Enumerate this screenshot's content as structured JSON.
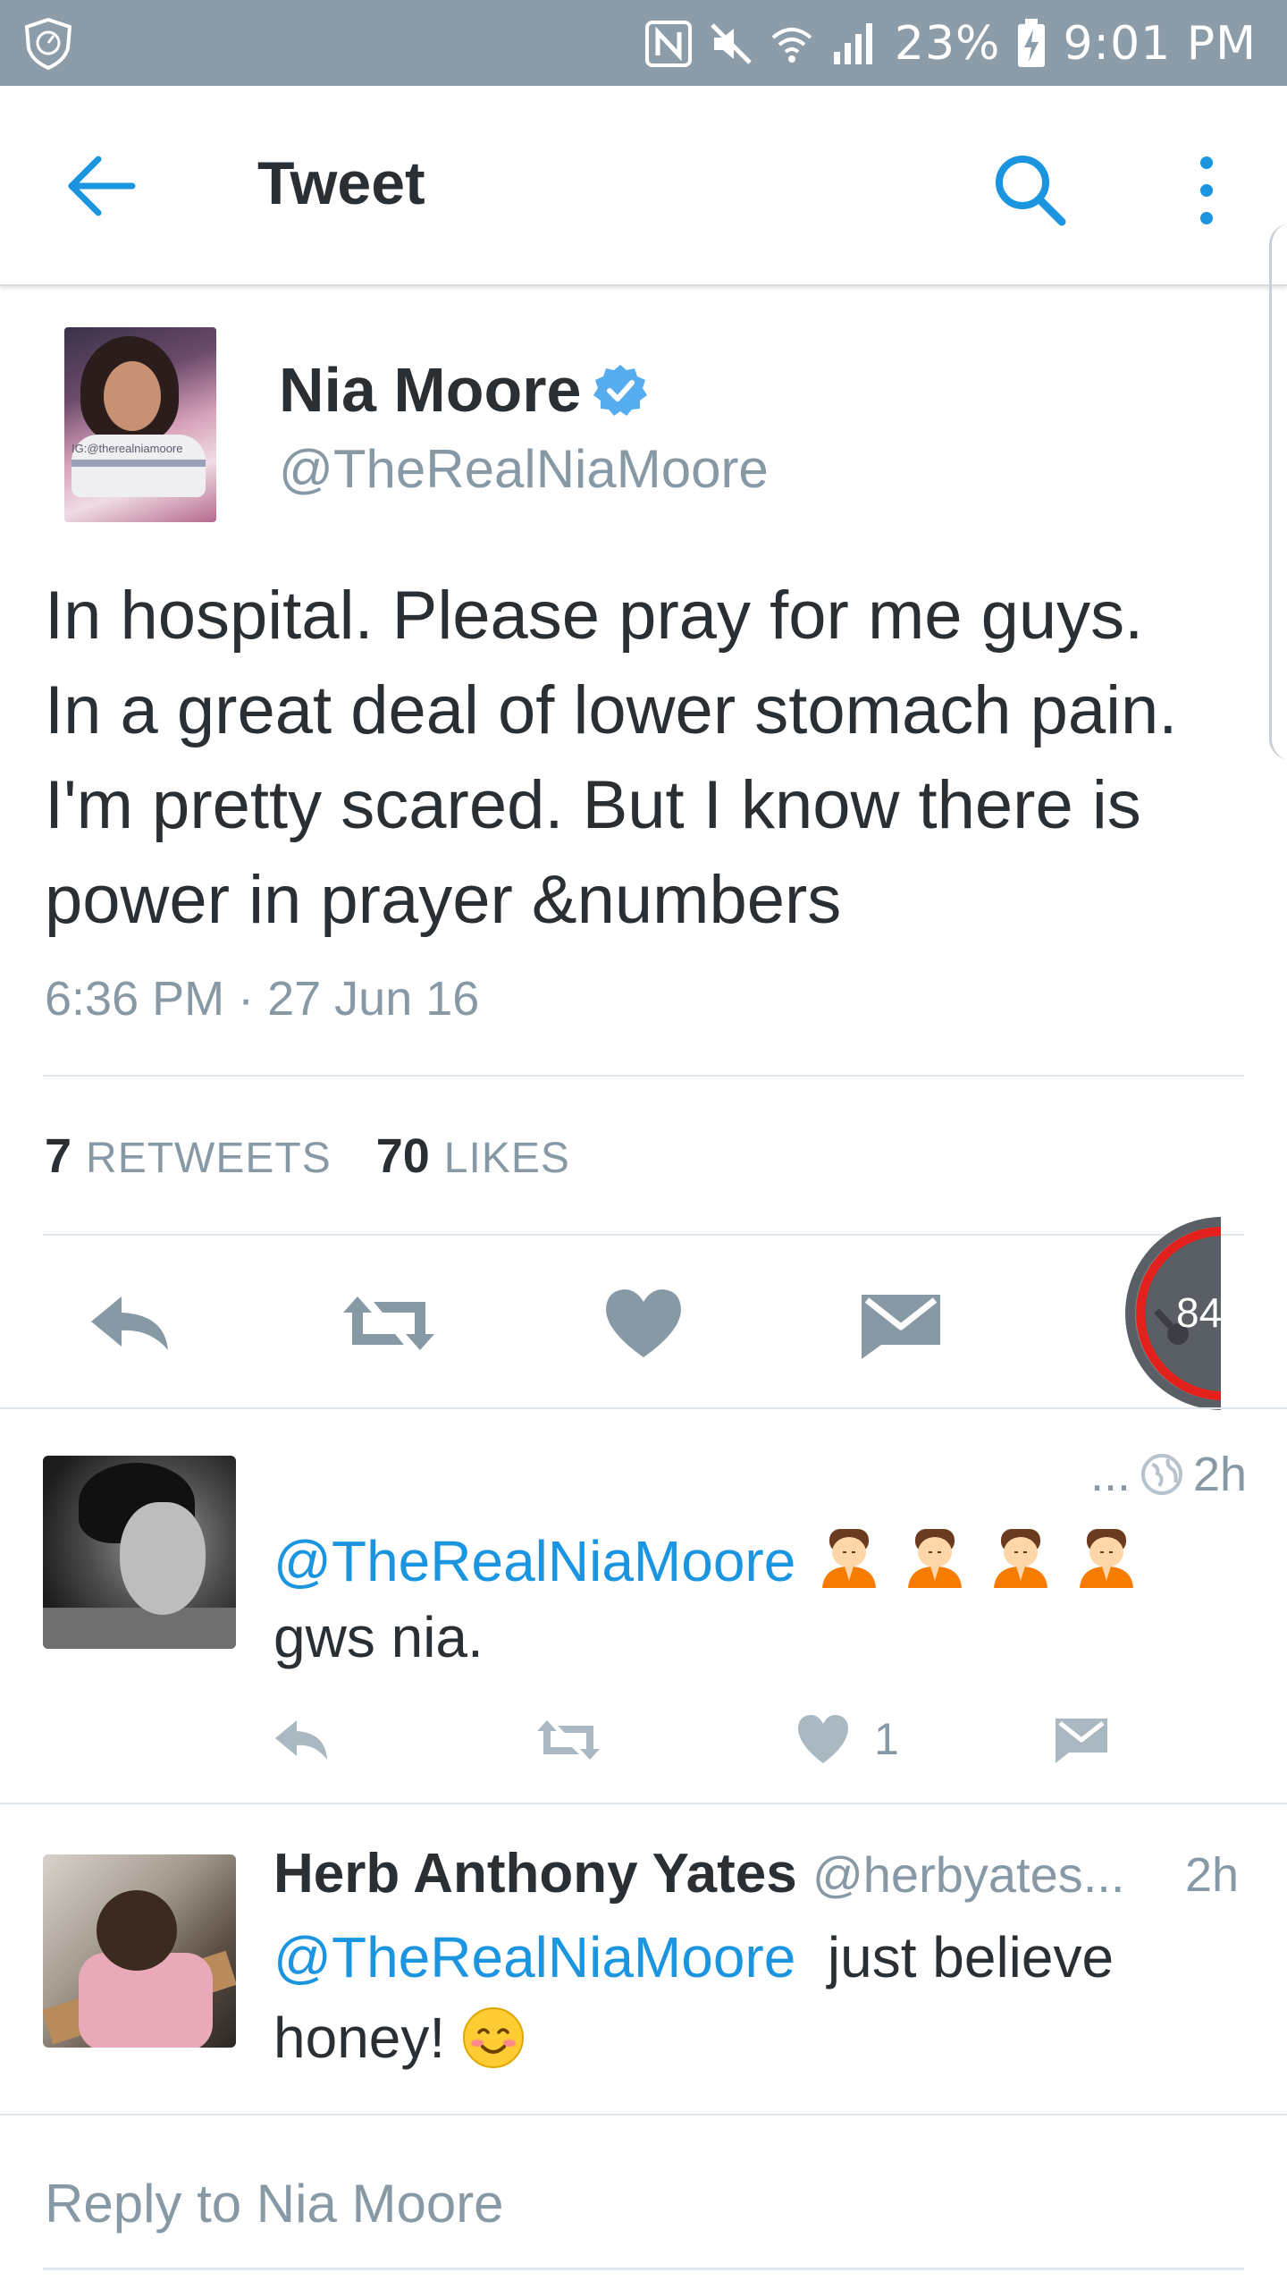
{
  "status_bar": {
    "battery": "23%",
    "time": "9:01 PM"
  },
  "toolbar": {
    "title": "Tweet"
  },
  "tweet": {
    "author_name": "Nia Moore",
    "author_handle": "@TheRealNiaMoore",
    "avatar_caption": "IG:@therealniamoore",
    "text_lines": [
      "In hospital. Please pray for me guys.",
      "In a great deal of lower stomach pain.",
      "I'm pretty scared. But I know there is",
      "power in prayer &numbers"
    ],
    "timestamp": "6:36 PM · 27 Jun 16",
    "retweets_count": "7",
    "retweets_label": "RETWEETS",
    "likes_count": "70",
    "likes_label": "LIKES"
  },
  "floating_badge": {
    "count": "84"
  },
  "replies": [
    {
      "meta_prefix": "...",
      "age": "2h",
      "mention": "@TheRealNiaMoore",
      "text": "gws nia.",
      "like_count": "1"
    },
    {
      "name": "Herb Anthony Yates",
      "handle": "@herbyates...",
      "age": "2h",
      "mention": "@TheRealNiaMoore",
      "text_line1": "just believe",
      "text_line2": "honey!"
    }
  ],
  "reply_box": {
    "placeholder": "Reply to Nia Moore"
  },
  "colors": {
    "status_bar": "#8d9ca9",
    "accent_blue": "#1b95e0",
    "icon_gray": "#8899a6",
    "text": "#292f33"
  }
}
